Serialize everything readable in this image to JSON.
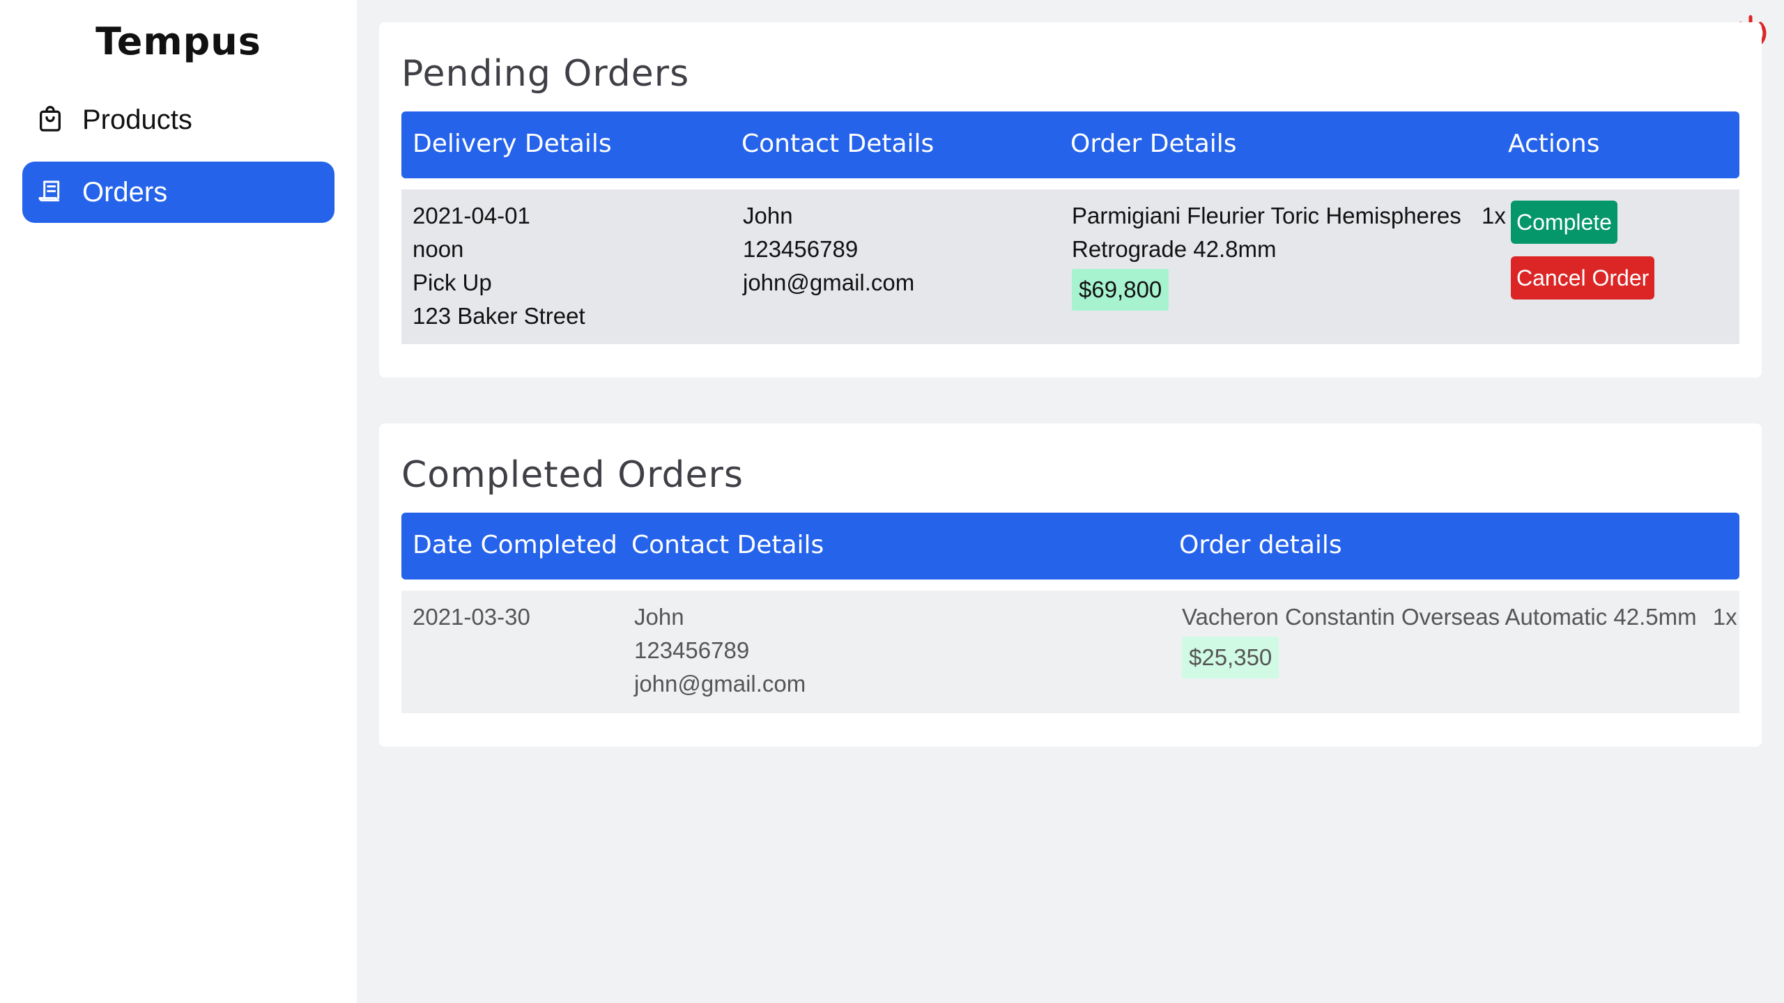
{
  "app": {
    "brand": "Tempus"
  },
  "sidebar": {
    "items": [
      {
        "label": "Products",
        "icon": "shopping-bag-icon",
        "active": false
      },
      {
        "label": "Orders",
        "icon": "receipt-icon",
        "active": true
      }
    ]
  },
  "header": {
    "power_icon": "power-icon",
    "power_color": "#dc2626"
  },
  "pending": {
    "title": "Pending Orders",
    "columns": [
      "Delivery Details",
      "Contact Details",
      "Order Details",
      "Actions"
    ],
    "rows": [
      {
        "delivery": {
          "date": "2021-04-01",
          "time": "noon",
          "method": "Pick Up",
          "address": "123 Baker Street"
        },
        "contact": {
          "name": "John",
          "phone": "123456789",
          "email": "john@gmail.com"
        },
        "order": {
          "item_line1": "Parmigiani Fleurier Toric Hemispheres",
          "item_line2": "Retrograde 42.8mm",
          "qty": "1x",
          "price": "$69,800"
        },
        "actions": {
          "complete": "Complete",
          "cancel": "Cancel Order"
        }
      }
    ]
  },
  "completed": {
    "title": "Completed Orders",
    "columns": [
      "Date Completed",
      "Contact Details",
      "Order details"
    ],
    "rows": [
      {
        "date": "2021-03-30",
        "contact": {
          "name": "John",
          "phone": "123456789",
          "email": "john@gmail.com"
        },
        "order": {
          "item": "Vacheron Constantin Overseas Automatic 42.5mm",
          "qty": "1x",
          "price": "$25,350"
        }
      }
    ]
  },
  "colors": {
    "accent": "#2563eb",
    "success": "#059669",
    "danger": "#dc2626",
    "price_bg": "#a7f3d0"
  }
}
